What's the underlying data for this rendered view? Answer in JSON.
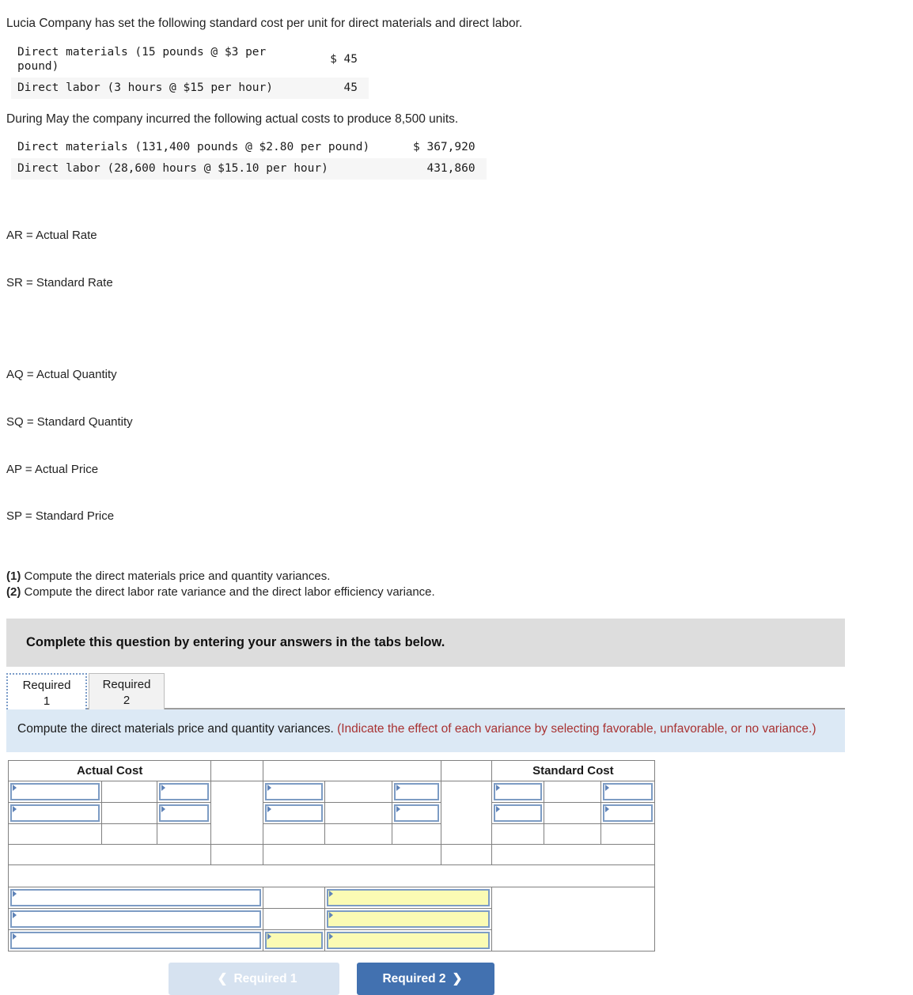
{
  "problem": {
    "intro_1": "Lucia Company has set the following standard cost per unit for direct materials and direct labor.",
    "standard_table": {
      "rows": [
        {
          "label": "Direct materials (15 pounds @ $3 per pound)",
          "amount": "$ 45"
        },
        {
          "label": "Direct labor (3 hours @ $15 per hour)",
          "amount": "45"
        }
      ]
    },
    "intro_2": "During May the company incurred the following actual costs to produce 8,500 units.",
    "actual_table": {
      "rows": [
        {
          "label": "Direct materials (131,400 pounds @ $2.80 per pound)",
          "amount": "$ 367,920"
        },
        {
          "label": "Direct labor (28,600 hours @ $15.10 per hour)",
          "amount": "431,860"
        }
      ]
    },
    "abbreviations_group_1": [
      "AR = Actual Rate",
      "SR = Standard Rate"
    ],
    "abbreviations_group_2": [
      "AQ = Actual Quantity",
      "SQ = Standard Quantity",
      "AP = Actual Price",
      "SP = Standard Price"
    ],
    "requirements": [
      {
        "num": "(1)",
        "text": " Compute the direct materials price and quantity variances."
      },
      {
        "num": "(2)",
        "text": " Compute the direct labor rate variance and the direct labor efficiency variance."
      }
    ]
  },
  "banner": {
    "text": "Complete this question by entering your answers in the tabs below."
  },
  "tabs": [
    {
      "line1": "Required",
      "line2": "1",
      "active": true
    },
    {
      "line1": "Required",
      "line2": "2",
      "active": false
    }
  ],
  "instruction": {
    "main": "Compute the direct materials price and quantity variances. ",
    "hint": "(Indicate the effect of each variance by selecting favorable, unfavorable, or no variance.)"
  },
  "answer_grid": {
    "headers": {
      "actual_cost": "Actual Cost",
      "middle": "",
      "standard_cost": "Standard Cost"
    },
    "cells": {
      "empty": ""
    }
  },
  "navigation": {
    "prev_label": "Required 1",
    "prev_icon": "chevron-left-icon",
    "prev_disabled": true,
    "next_label": "Required 2",
    "next_icon": "chevron-right-icon"
  },
  "colors": {
    "header_blue": "#8eaadb",
    "input_border_blue": "#7d9cc4",
    "highlight_yellow": "#fbfbb4",
    "instruction_blue_bg": "#dce9f5",
    "hint_red": "#a83232",
    "banner_gray": "#dddddd",
    "button_active_blue": "#4271b0",
    "button_disabled_blue": "#d6e2f0"
  }
}
